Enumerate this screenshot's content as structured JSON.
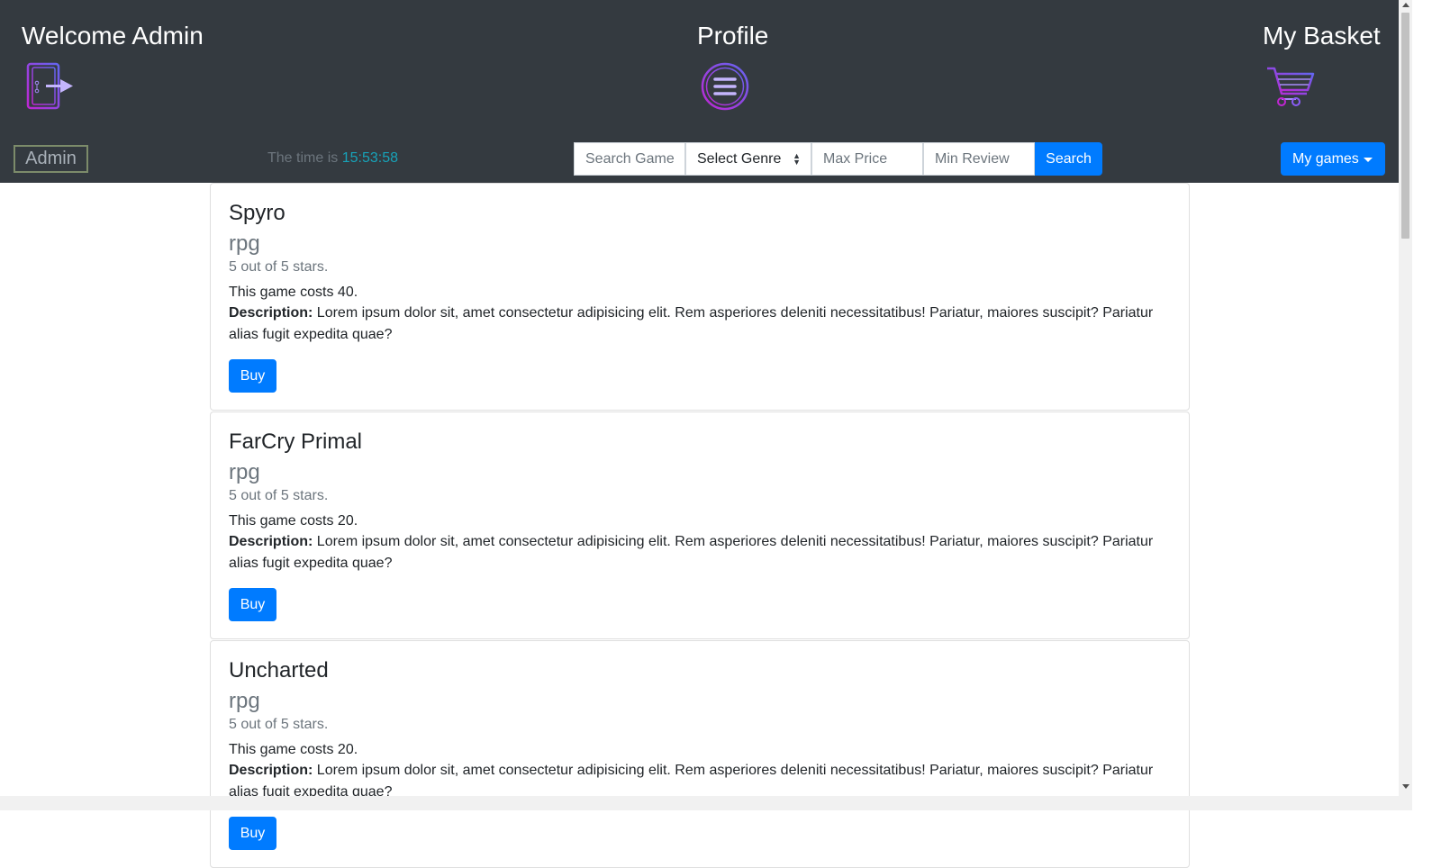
{
  "header": {
    "welcome": "Welcome Admin",
    "profile": "Profile",
    "basket": "My Basket",
    "icons": {
      "logout": "logout-door-icon",
      "menu": "hamburger-menu-icon",
      "cart": "shopping-cart-icon"
    },
    "colors": {
      "background": "#343a40",
      "icon_gradient_start": "#c026d3",
      "icon_gradient_end": "#6366f1"
    }
  },
  "toolbar": {
    "admin_label": "Admin",
    "time_prefix": "The time is",
    "time_value": "15:53:58",
    "search": {
      "game_placeholder": "Search Game",
      "genre_selected": "Select Genre",
      "max_price_placeholder": "Max Price",
      "min_review_placeholder": "Min Review",
      "button_label": "Search"
    },
    "my_games_label": "My games",
    "colors": {
      "primary": "#007bff",
      "time": "#17a2b8"
    }
  },
  "games": [
    {
      "title": "Spyro",
      "genre": "rpg",
      "stars": "5 out of 5 stars.",
      "price_text": "This game costs 40.",
      "description_label": "Description:",
      "description": "Lorem ipsum dolor sit, amet consectetur adipisicing elit. Rem asperiores deleniti necessitatibus! Pariatur, maiores suscipit? Pariatur alias fugit expedita quae?",
      "buy_label": "Buy"
    },
    {
      "title": "FarCry Primal",
      "genre": "rpg",
      "stars": "5 out of 5 stars.",
      "price_text": "This game costs 20.",
      "description_label": "Description:",
      "description": "Lorem ipsum dolor sit, amet consectetur adipisicing elit. Rem asperiores deleniti necessitatibus! Pariatur, maiores suscipit? Pariatur alias fugit expedita quae?",
      "buy_label": "Buy"
    },
    {
      "title": "Uncharted",
      "genre": "rpg",
      "stars": "5 out of 5 stars.",
      "price_text": "This game costs 20.",
      "description_label": "Description:",
      "description": "Lorem ipsum dolor sit, amet consectetur adipisicing elit. Rem asperiores deleniti necessitatibus! Pariatur, maiores suscipit? Pariatur alias fugit expedita quae?",
      "buy_label": "Buy"
    }
  ]
}
